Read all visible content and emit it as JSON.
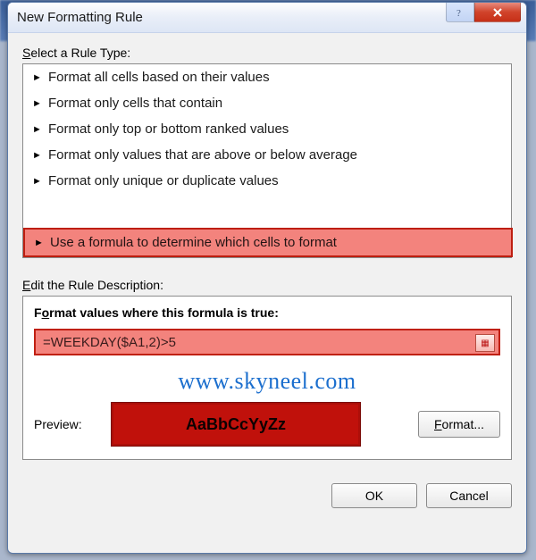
{
  "title": "New Formatting Rule",
  "sections": {
    "select_label_pre": "S",
    "select_label_post": "elect a Rule Type:",
    "edit_label_pre": "E",
    "edit_label_post": "dit the Rule Description:"
  },
  "rule_types": [
    "Format all cells based on their values",
    "Format only cells that contain",
    "Format only top or bottom ranked values",
    "Format only values that are above or below average",
    "Format only unique or duplicate values",
    "Use a formula to determine which cells to format"
  ],
  "selected_rule_index": 5,
  "description": {
    "heading_pre": "F",
    "heading_u": "o",
    "heading_post": "rmat values where this formula is true:",
    "formula": "=WEEKDAY($A1,2)>5"
  },
  "watermark": "www.skyneel.com",
  "preview": {
    "label": "Preview:",
    "sample": "AaBbCcYyZz",
    "format_btn_pre": "F",
    "format_btn_post": "ormat..."
  },
  "buttons": {
    "ok": "OK",
    "cancel": "Cancel"
  }
}
